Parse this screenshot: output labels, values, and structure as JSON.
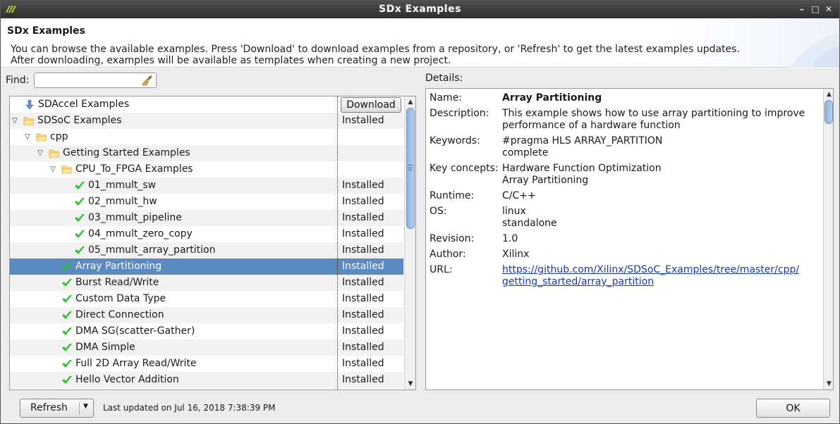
{
  "window": {
    "title": "SDx Examples",
    "controls": {
      "minimize": "–",
      "maximize": "□",
      "close": "✕"
    }
  },
  "header": {
    "title": "SDx Examples",
    "message_line1": "You can browse the available examples. Press 'Download' to download examples from a repository, or 'Refresh' to get the latest examples updates.",
    "message_line2": "After downloading, examples will be available as templates when creating a new project."
  },
  "find": {
    "label": "Find:",
    "value": "",
    "placeholder": ""
  },
  "tree": {
    "download_label": "Download",
    "rows": [
      {
        "name": "SDAccel Examples",
        "status": "",
        "icon": "download-arrow-icon",
        "depth": 0,
        "expanded": null
      },
      {
        "name": "SDSoC Examples",
        "status": "Installed",
        "icon": "folder-icon",
        "depth": 0,
        "expanded": true
      },
      {
        "name": "cpp",
        "status": "",
        "icon": "folder-icon",
        "depth": 1,
        "expanded": true
      },
      {
        "name": "Getting Started Examples",
        "status": "",
        "icon": "folder-icon",
        "depth": 2,
        "expanded": true
      },
      {
        "name": "CPU_To_FPGA Examples",
        "status": "",
        "icon": "folder-icon",
        "depth": 3,
        "expanded": true
      },
      {
        "name": "01_mmult_sw",
        "status": "Installed",
        "icon": "check-icon",
        "depth": 4
      },
      {
        "name": "02_mmult_hw",
        "status": "Installed",
        "icon": "check-icon",
        "depth": 4
      },
      {
        "name": "03_mmult_pipeline",
        "status": "Installed",
        "icon": "check-icon",
        "depth": 4
      },
      {
        "name": "04_mmult_zero_copy",
        "status": "Installed",
        "icon": "check-icon",
        "depth": 4
      },
      {
        "name": "05_mmult_array_partition",
        "status": "Installed",
        "icon": "check-icon",
        "depth": 4
      },
      {
        "name": "Array Partitioning",
        "status": "Installed",
        "icon": "check-icon",
        "depth": 3,
        "selected": true
      },
      {
        "name": "Burst Read/Write",
        "status": "Installed",
        "icon": "check-icon",
        "depth": 3
      },
      {
        "name": "Custom Data Type",
        "status": "Installed",
        "icon": "check-icon",
        "depth": 3
      },
      {
        "name": "Direct Connection",
        "status": "Installed",
        "icon": "check-icon",
        "depth": 3
      },
      {
        "name": "DMA SG(scatter-Gather)",
        "status": "Installed",
        "icon": "check-icon",
        "depth": 3
      },
      {
        "name": "DMA Simple",
        "status": "Installed",
        "icon": "check-icon",
        "depth": 3
      },
      {
        "name": "Full 2D Array Read/Write",
        "status": "Installed",
        "icon": "check-icon",
        "depth": 3
      },
      {
        "name": "Hello Vector Addition",
        "status": "Installed",
        "icon": "check-icon",
        "depth": 3
      }
    ]
  },
  "details": {
    "label": "Details:",
    "fields": [
      {
        "key": "Name:",
        "lines": [
          "Array Partitioning"
        ],
        "bold": true
      },
      {
        "key": "Description:",
        "lines": [
          "This example shows how to use array partitioning to improve",
          "performance of a hardware function"
        ]
      },
      {
        "key": "Keywords:",
        "lines": [
          "#pragma HLS ARRAY_PARTITION",
          "complete"
        ]
      },
      {
        "key": "Key concepts:",
        "lines": [
          "Hardware Function Optimization",
          "Array Partitioning"
        ]
      },
      {
        "key": "Runtime:",
        "lines": [
          "C/C++"
        ]
      },
      {
        "key": "OS:",
        "lines": [
          "linux",
          "standalone"
        ]
      },
      {
        "key": "Revision:",
        "lines": [
          "1.0"
        ]
      },
      {
        "key": "Author:",
        "lines": [
          "Xilinx"
        ]
      },
      {
        "key": "URL:",
        "lines": [
          "https://github.com/Xilinx/SDSoC_Examples/tree/master/cpp/",
          "getting_started/array_partition"
        ],
        "link": true
      }
    ]
  },
  "footer": {
    "refresh_label": "Refresh",
    "last_updated": "Last updated on Jul 16, 2018 7:38:39 PM",
    "ok_label": "OK"
  },
  "colors": {
    "selection": "#5b8ac1",
    "check": "#2fbf2f",
    "folder": "#e8b84a",
    "link": "#1a36b8"
  }
}
